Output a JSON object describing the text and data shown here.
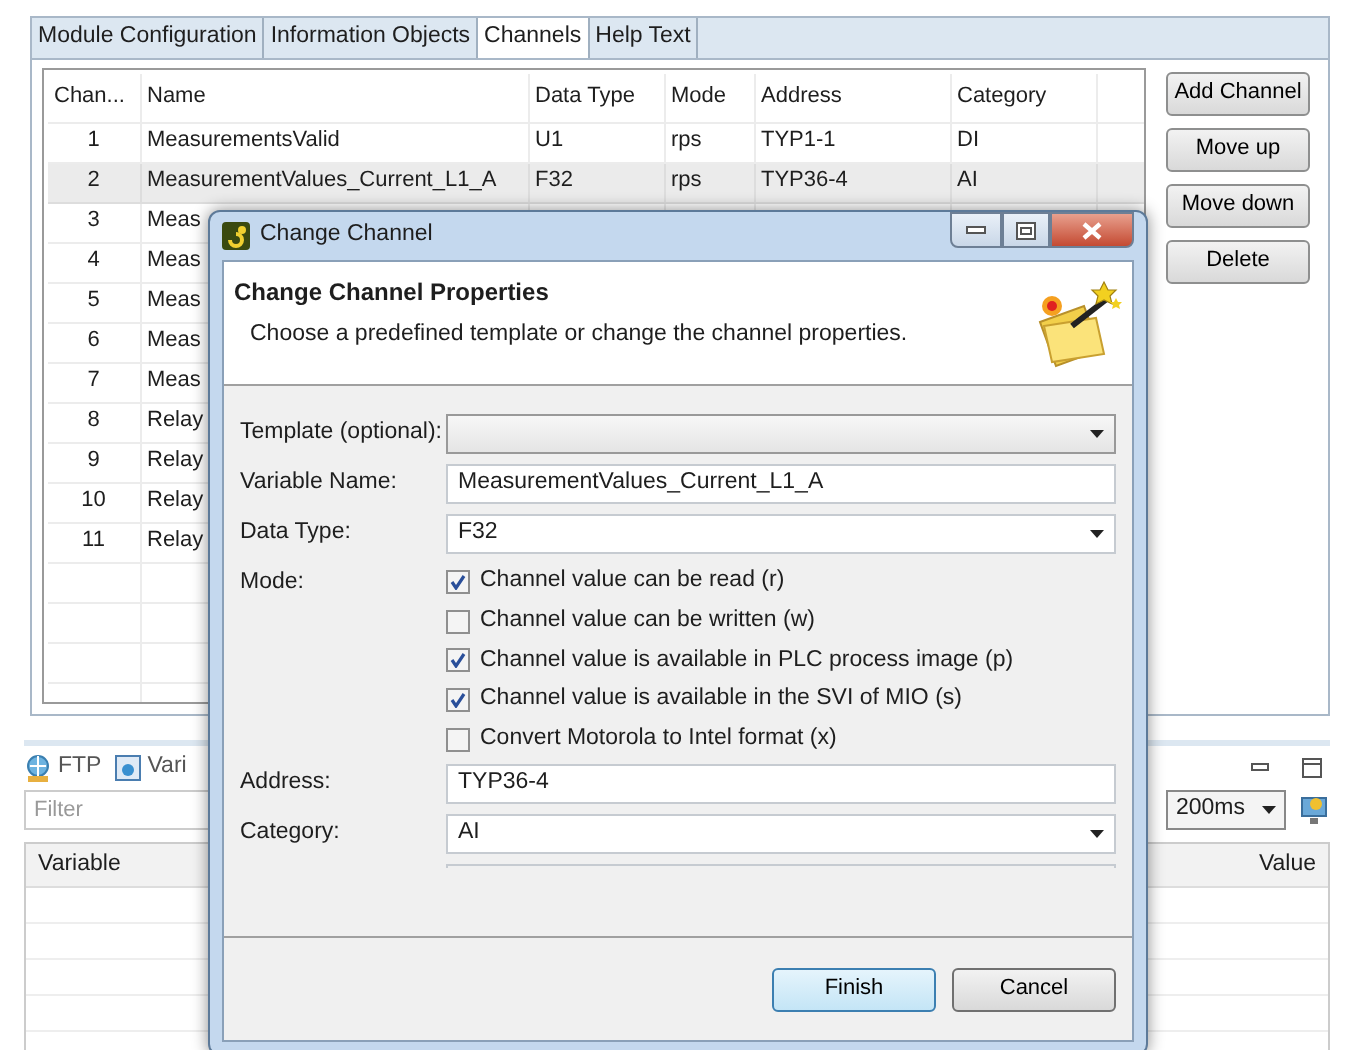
{
  "tabs": [
    {
      "label": "Module Configuration",
      "selected": false
    },
    {
      "label": "Information Objects",
      "selected": false
    },
    {
      "label": "Channels",
      "selected": true
    },
    {
      "label": "Help Text",
      "selected": false
    }
  ],
  "channels_table": {
    "columns": [
      "Chan...",
      "Name",
      "Data Type",
      "Mode",
      "Address",
      "Category"
    ],
    "rows": [
      {
        "cells": [
          "1",
          "MeasurementsValid",
          "U1",
          "rps",
          "TYP1-1",
          "DI"
        ],
        "selected": false
      },
      {
        "cells": [
          "2",
          "MeasurementValues_Current_L1_A",
          "F32",
          "rps",
          "TYP36-4",
          "AI"
        ],
        "selected": true
      },
      {
        "cells": [
          "3",
          "Meas"
        ],
        "selected": false
      },
      {
        "cells": [
          "4",
          "Meas"
        ],
        "selected": false
      },
      {
        "cells": [
          "5",
          "Meas"
        ],
        "selected": false
      },
      {
        "cells": [
          "6",
          "Meas"
        ],
        "selected": false
      },
      {
        "cells": [
          "7",
          "Meas"
        ],
        "selected": false
      },
      {
        "cells": [
          "8",
          "Relay"
        ],
        "selected": false
      },
      {
        "cells": [
          "9",
          "Relay"
        ],
        "selected": false
      },
      {
        "cells": [
          "10",
          "Relay"
        ],
        "selected": false
      },
      {
        "cells": [
          "11",
          "Relay"
        ],
        "selected": false
      }
    ]
  },
  "side_buttons": [
    "Add Channel",
    "Move up",
    "Move down",
    "Delete"
  ],
  "bottom_panel": {
    "tabs": [
      {
        "label": "FTP",
        "kind": "ftp"
      },
      {
        "label": "Vari",
        "kind": "variables"
      }
    ],
    "filter": {
      "placeholder": "Filter"
    },
    "refresh_rate": "200ms",
    "columns": [
      "Variable",
      "Value"
    ]
  },
  "dialog": {
    "title": "Change Channel",
    "heading": "Change Channel Properties",
    "description": "Choose a predefined template or change the channel properties.",
    "fields": [
      {
        "kind": "combo",
        "label": "Template (optional):"
      },
      {
        "kind": "text",
        "label": "Variable Name:",
        "value": "MeasurementValues_Current_L1_A"
      },
      {
        "kind": "combo",
        "label": "Data Type:",
        "value": "F32"
      },
      {
        "kind": "checks",
        "label": "Mode:",
        "options": [
          {
            "label": "Channel value can be read (r)",
            "checked": true
          },
          {
            "label": "Channel value can be written (w)",
            "checked": false
          },
          {
            "label": "Channel value is available in PLC process image (p)",
            "checked": true
          },
          {
            "label": "Channel value is available in the SVI of MIO (s)",
            "checked": true
          },
          {
            "label": "Convert Motorola to Intel format (x)",
            "checked": false
          }
        ]
      },
      {
        "kind": "text",
        "label": "Address:",
        "value": "TYP36-4"
      },
      {
        "kind": "combo",
        "label": "Category:",
        "value": "AI"
      }
    ],
    "buttons": [
      {
        "label": "Finish",
        "default": true
      },
      {
        "label": "Cancel",
        "default": false
      }
    ]
  }
}
